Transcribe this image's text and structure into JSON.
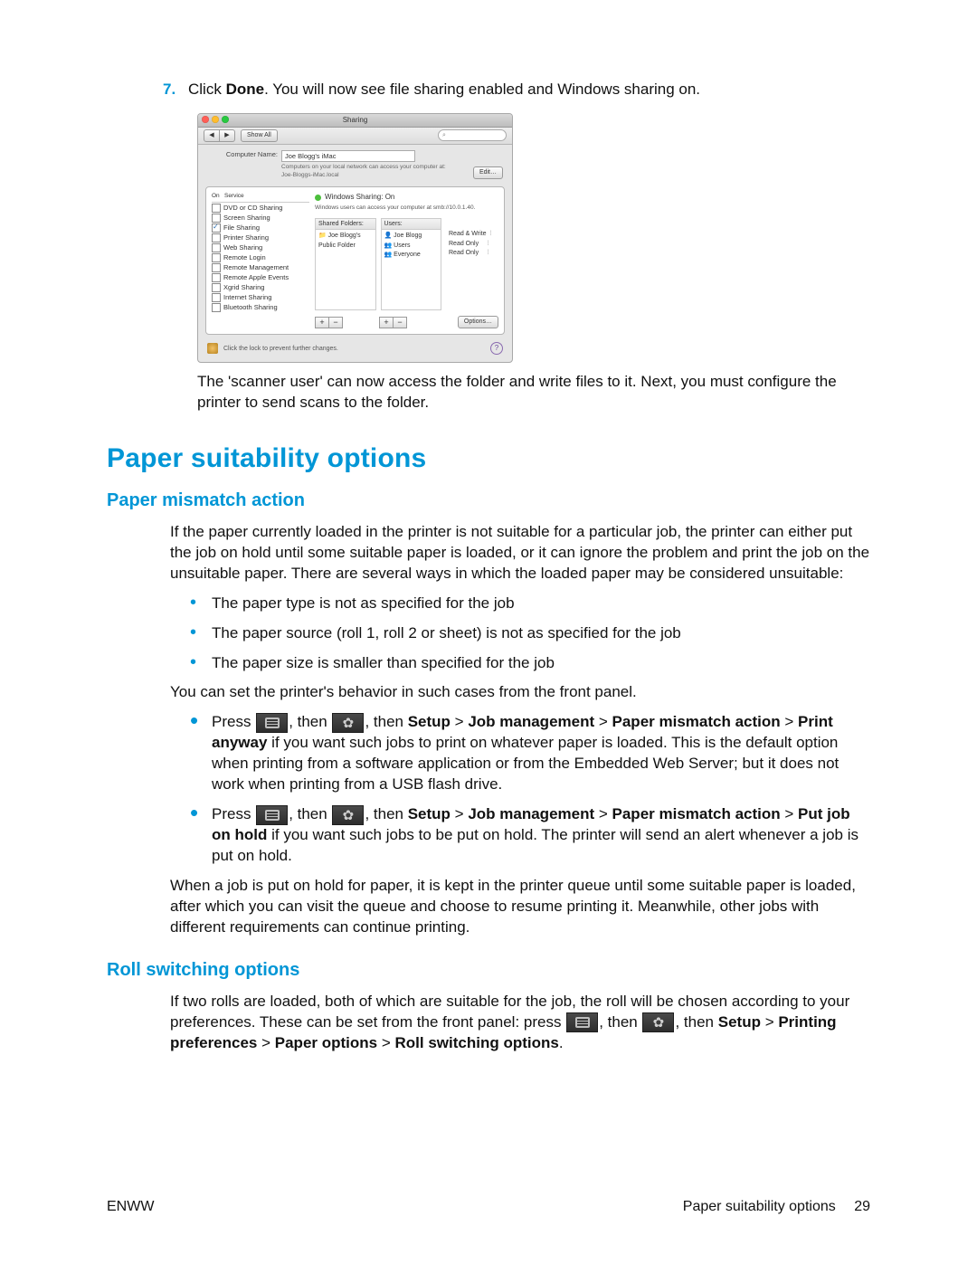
{
  "step": {
    "number": "7.",
    "text_before": "Click ",
    "bold": "Done",
    "text_after": ". You will now see file sharing enabled and Windows sharing on."
  },
  "mac": {
    "title": "Sharing",
    "showall": "Show All",
    "search_glyph": "⌕",
    "comp_name_label": "Computer Name:",
    "comp_name_value": "Joe Blogg's iMac",
    "comp_sub": "Computers on your local network can access your computer at: Joe-Bloggs-iMac.local",
    "edit_btn": "Edit…",
    "svc_head_on": "On",
    "svc_head_service": "Service",
    "services": [
      {
        "on": false,
        "label": "DVD or CD Sharing"
      },
      {
        "on": false,
        "label": "Screen Sharing"
      },
      {
        "on": true,
        "label": "File Sharing"
      },
      {
        "on": false,
        "label": "Printer Sharing"
      },
      {
        "on": false,
        "label": "Web Sharing"
      },
      {
        "on": false,
        "label": "Remote Login"
      },
      {
        "on": false,
        "label": "Remote Management"
      },
      {
        "on": false,
        "label": "Remote Apple Events"
      },
      {
        "on": false,
        "label": "Xgrid Sharing"
      },
      {
        "on": false,
        "label": "Internet Sharing"
      },
      {
        "on": false,
        "label": "Bluetooth Sharing"
      }
    ],
    "status_title": "Windows Sharing: On",
    "status_sub": "Windows users can access your computer at smb://10.0.1.40.",
    "folders_head": "Shared Folders:",
    "folders_body": "📁 Joe Blogg's Public Folder",
    "users_head": "Users:",
    "users": [
      {
        "name": "👤 Joe Blogg",
        "perm": "Read & Write  ⫶"
      },
      {
        "name": "👥 Users",
        "perm": "Read Only     ⫶"
      },
      {
        "name": "👥 Everyone",
        "perm": "Read Only     ⫶"
      }
    ],
    "options_btn": "Options…",
    "lock_text": "Click the lock to prevent further changes.",
    "help": "?"
  },
  "after_shot": "The 'scanner user' can now access the folder and write files to it. Next, you must configure the printer to send scans to the folder.",
  "h1": "Paper suitability options",
  "mismatch": {
    "title": "Paper mismatch action",
    "p1": "If the paper currently loaded in the printer is not suitable for a particular job, the printer can either put the job on hold until some suitable paper is loaded, or it can ignore the problem and print the job on the unsuitable paper. There are several ways in which the loaded paper may be considered unsuitable:",
    "b1": "The paper type is not as specified for the job",
    "b2": "The paper source (roll 1, roll 2 or sheet) is not as specified for the job",
    "b3": "The paper size is smaller than specified for the job",
    "p2": "You can set the printer's behavior in such cases from the front panel.",
    "press": "Press ",
    "then": ", then ",
    "then2": ", then ",
    "path1a": "Setup",
    "path1b": "Job management",
    "path1c": "Paper mismatch action",
    "opt1": "Print anyway",
    "c1_tail": " if you want such jobs to print on whatever paper is loaded. This is the default option when printing from a software application or from the Embedded Web Server; but it does not work when printing from a USB flash drive.",
    "opt2": "Put job on hold",
    "c2_tail": " if you want such jobs to be put on hold. The printer will send an alert whenever a job is put on hold.",
    "p3": "When a job is put on hold for paper, it is kept in the printer queue until some suitable paper is loaded, after which you can visit the queue and choose to resume printing it. Meanwhile, other jobs with different requirements can continue printing."
  },
  "roll": {
    "title": "Roll switching options",
    "p1a": "If two rolls are loaded, both of which are suitable for the job, the roll will be chosen according to your preferences. These can be set from the front panel: press ",
    "setup": "Setup",
    "pref": "Printing preferences",
    "popt": "Paper options",
    "rso": "Roll switching options",
    "period": "."
  },
  "footer": {
    "left": "ENWW",
    "right": "Paper suitability options",
    "page": "29"
  },
  "gt": " > "
}
